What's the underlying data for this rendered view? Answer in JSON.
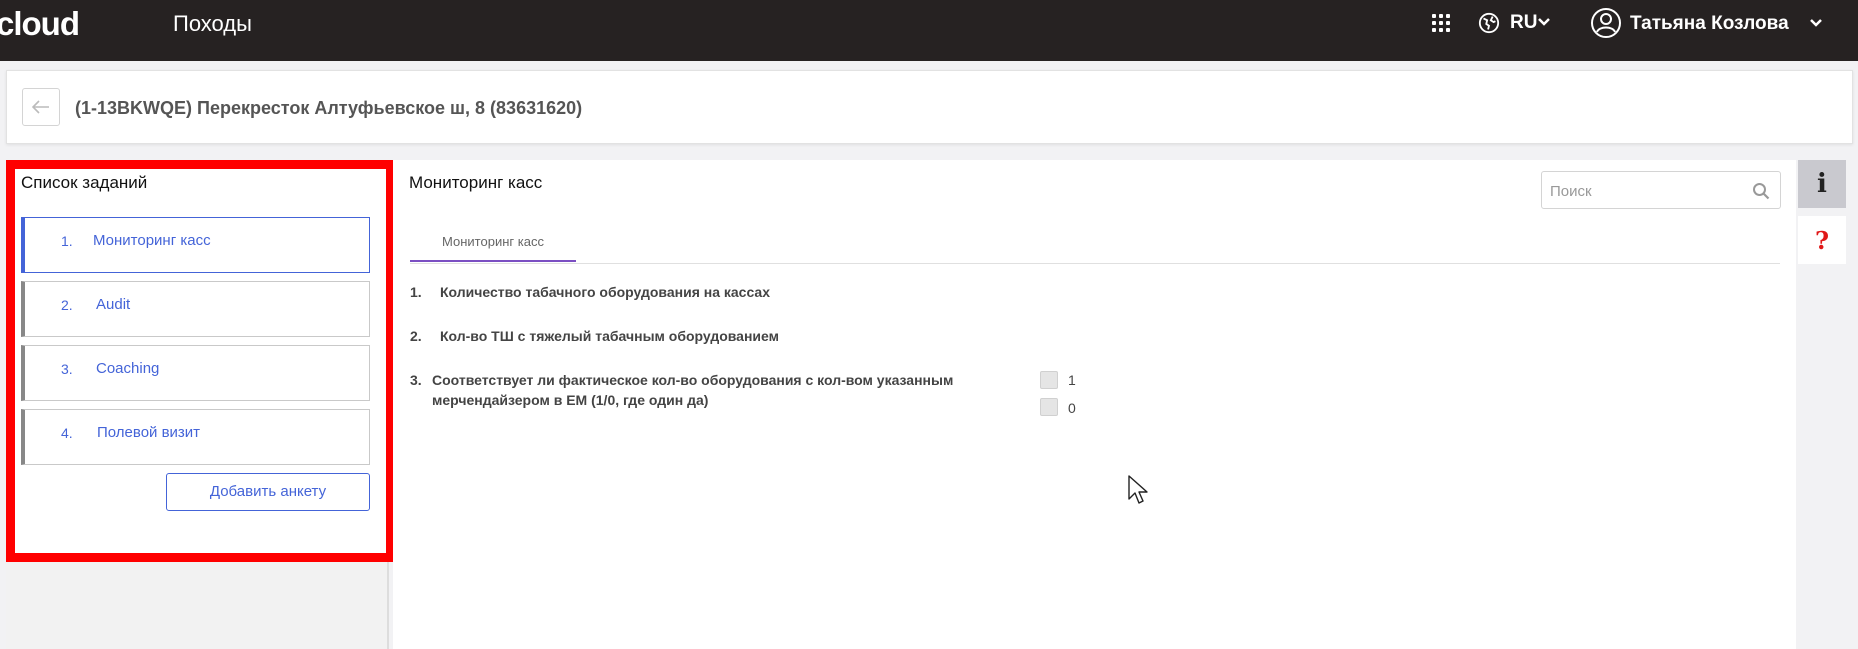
{
  "topbar": {
    "logo_text": "cloud",
    "app_title": "Походы",
    "language": "RU",
    "user_name": "Татьяна Козлова"
  },
  "header": {
    "title": "(1-13BKWQE) Перекресток Алтуфьевское ш, 8 (83631620)"
  },
  "sidebar": {
    "title": "Список заданий",
    "items": [
      {
        "num": "1.",
        "label": "Мониторинг касс",
        "active": true
      },
      {
        "num": "2.",
        "label": "Audit",
        "active": false
      },
      {
        "num": "3.",
        "label": "Coaching",
        "active": false
      },
      {
        "num": "4.",
        "label": "Полевой визит",
        "active": false
      }
    ],
    "add_button": "Добавить анкету"
  },
  "main": {
    "title": "Мониторинг касс",
    "search_placeholder": "Поиск",
    "tab": "Мониторинг касс",
    "questions": [
      {
        "num": "1.",
        "text": "Количество табачного оборудования на кассах"
      },
      {
        "num": "2.",
        "text": "Кол-во ТШ с тяжелый табачным оборудованием"
      },
      {
        "num": "3.",
        "text": "Соответствует ли фактическое кол-во оборудования с кол-вом указанным мерчендайзером в ЕМ (1/0, где один да)"
      }
    ],
    "options": [
      "1",
      "0"
    ]
  },
  "side_actions": {
    "info": "i",
    "help": "?"
  },
  "colors": {
    "accent": "#4464d8",
    "highlight": "#ff0000",
    "tab_underline": "#7b4fc2",
    "topbar": "#262222"
  }
}
